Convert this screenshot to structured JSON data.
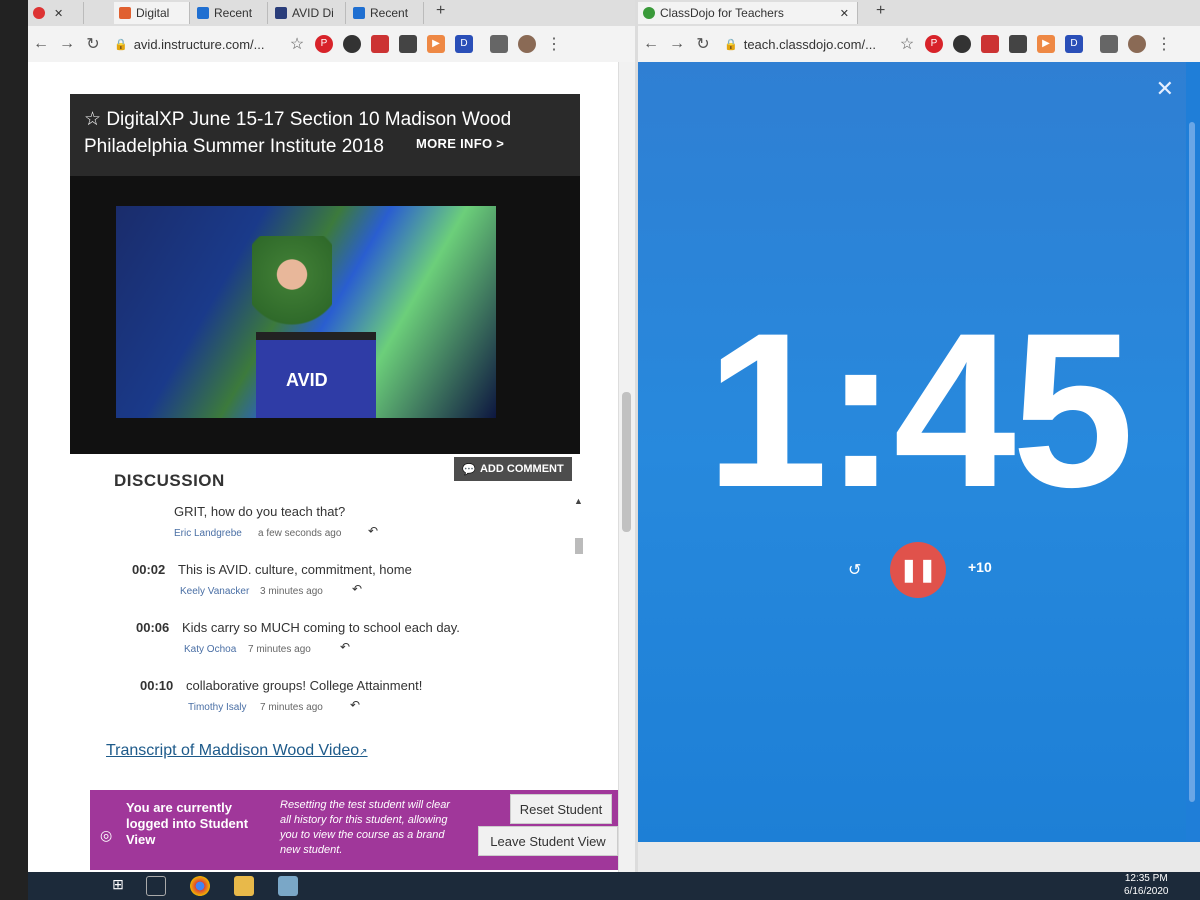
{
  "left_browser": {
    "tabs": [
      {
        "label": "Digital",
        "color": "#e06030"
      },
      {
        "label": "Recent",
        "color": "#1f6fd1"
      },
      {
        "label": "AVID Di",
        "color": "#2a3d7a"
      },
      {
        "label": "Recent",
        "color": "#1f6fd1"
      }
    ],
    "url": "avid.instructure.com/...",
    "video_title": "DigitalXP June 15-17 Section 10 Madison Wood Philadelphia Summer Institute 2018",
    "more_info": "MORE INFO >",
    "podium_logo": "AVID",
    "discussion_title": "DISCUSSION",
    "add_comment": "ADD COMMENT",
    "comments": [
      {
        "time": "",
        "text": "GRIT, how do you teach that?",
        "author": "Eric Landgrebe",
        "ago": "a few seconds ago"
      },
      {
        "time": "00:02",
        "text": "This is AVID. culture, commitment, home",
        "author": "Keely Vanacker",
        "ago": "3 minutes ago"
      },
      {
        "time": "00:06",
        "text": "Kids carry so MUCH coming to school each day.",
        "author": "Katy Ochoa",
        "ago": "7 minutes ago"
      },
      {
        "time": "00:10",
        "text": "collaborative groups! College Attainment!",
        "author": "Timothy Isaly",
        "ago": "7 minutes ago"
      }
    ],
    "transcript_link": "Transcript of Maddison Wood Video",
    "student_bar": {
      "message": "You are currently logged into Student View",
      "note": "Resetting the test student will clear all history for this student, allowing you to view the course as a brand new student.",
      "reset_button": "Reset Student",
      "leave_button": "Leave Student View"
    }
  },
  "right_browser": {
    "tab_label": "ClassDojo for Teachers",
    "url": "teach.classdojo.com/...",
    "timer": "1:45",
    "plus_label": "+10"
  },
  "taskbar": {
    "time": "12:35 PM",
    "date": "6/16/2020"
  },
  "colors": {
    "student_bar": "#a0379a",
    "dojo_blue": "#2789dd",
    "pause_red": "#e0524b"
  }
}
